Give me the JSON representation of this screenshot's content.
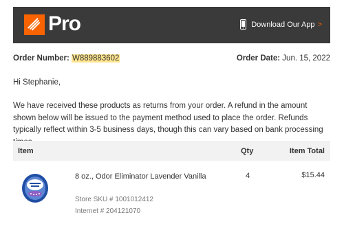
{
  "header": {
    "brand_text": "Pro",
    "logo_alt": "THE HOME DEPOT",
    "app_link_label": "Download Our App",
    "app_link_arrow": ">",
    "icons": {
      "phone": "smartphone-icon",
      "logo": "home-depot-logo-icon"
    },
    "colors": {
      "bar": "#3a3a3a",
      "brand": "#f96302"
    }
  },
  "order": {
    "number_label": "Order Number:",
    "number": "W889883602",
    "date_label": "Order Date:",
    "date": "Jun. 15, 2022"
  },
  "greeting": "Hi Stephanie,",
  "message": "We have received these products as returns from your order. A refund in the amount shown below will be issued to the payment method used to place the order. Refunds typically reflect within 3-5 business days, though this can vary based on bank processing times.",
  "table": {
    "headers": {
      "item": "Item",
      "qty": "Qty",
      "total": "Item Total"
    },
    "rows": [
      {
        "name": "8 oz., Odor Eliminator Lavender Vanilla",
        "qty": "4",
        "total": "$15.44",
        "store_sku": "Store SKU # 1001012412",
        "internet": "Internet # 204121070",
        "image_icon": "odor-genie-product-icon"
      }
    ]
  }
}
